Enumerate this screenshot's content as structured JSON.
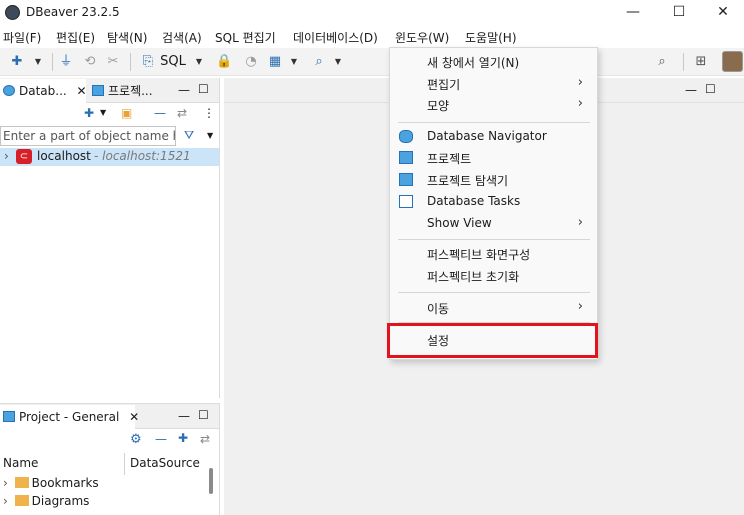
{
  "app": {
    "title": "DBeaver 23.2.5"
  },
  "window_controls": {
    "minimize": "—",
    "maximize": "☐",
    "close": "✕"
  },
  "menubar": {
    "items": [
      {
        "label": "파일(F)"
      },
      {
        "label": "편집(E)"
      },
      {
        "label": "탐색(N)"
      },
      {
        "label": "검색(A)"
      },
      {
        "label": "SQL 편집기"
      },
      {
        "label": "데이터베이스(D)"
      },
      {
        "label": "윈도우(W)"
      },
      {
        "label": "도움말(H)"
      }
    ]
  },
  "toolbar": {
    "sql_label": "SQL"
  },
  "navigator": {
    "tab_db": "Datab...",
    "tab_project": "프로젝...",
    "filter_placeholder": "Enter a part of object name here",
    "connection": {
      "name": "localhost",
      "detail": "- localhost:1521"
    }
  },
  "project_panel": {
    "tab": "Project - General",
    "columns": [
      "Name",
      "DataSource"
    ],
    "items": [
      {
        "label": "Bookmarks"
      },
      {
        "label": "Diagrams"
      }
    ]
  },
  "window_menu": {
    "items": [
      {
        "label": "새 창에서 열기(N)",
        "submenu": false
      },
      {
        "label": "편집기",
        "submenu": true
      },
      {
        "label": "모양",
        "submenu": true
      },
      {
        "label": "Database Navigator",
        "icon": "database-icon"
      },
      {
        "label": "프로젝트",
        "icon": "project-icon"
      },
      {
        "label": "프로젝트 탐색기",
        "icon": "project-explorer-icon"
      },
      {
        "label": "Database Tasks",
        "icon": "tasks-icon"
      },
      {
        "label": "Show View",
        "submenu": true
      },
      {
        "label": "퍼스펙티브 화면구성"
      },
      {
        "label": "퍼스펙티브 초기화"
      },
      {
        "label": "이동",
        "submenu": true
      },
      {
        "label": "설정",
        "highlighted": true
      }
    ]
  },
  "colors": {
    "highlight": "#e0131f",
    "selection": "#cce4f7",
    "accent": "#2473b8"
  }
}
